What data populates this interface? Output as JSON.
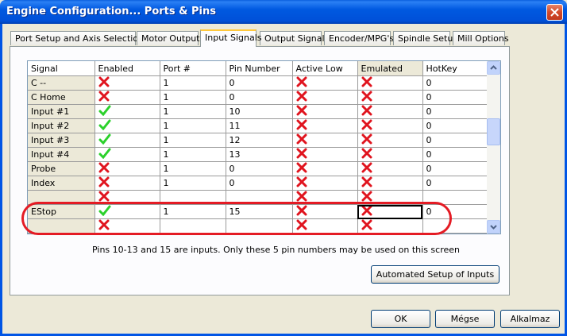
{
  "window": {
    "title": "Engine Configuration... Ports & Pins",
    "close_icon": "close-icon"
  },
  "tabs": [
    {
      "label": "Port Setup and Axis Selection",
      "active": false
    },
    {
      "label": "Motor Outputs",
      "active": false
    },
    {
      "label": "Input Signals",
      "active": true
    },
    {
      "label": "Output Signals",
      "active": false
    },
    {
      "label": "Encoder/MPG's",
      "active": false
    },
    {
      "label": "Spindle Setup",
      "active": false
    },
    {
      "label": "Mill Options",
      "active": false
    }
  ],
  "grid": {
    "columns": [
      "Signal",
      "Enabled",
      "Port #",
      "Pin Number",
      "Active Low",
      "Emulated",
      "HotKey"
    ],
    "rows": [
      {
        "signal": "C --",
        "enabled": false,
        "port": "1",
        "pin": "0",
        "active_low": false,
        "emulated": false,
        "hotkey": "0"
      },
      {
        "signal": "C Home",
        "enabled": false,
        "port": "1",
        "pin": "0",
        "active_low": false,
        "emulated": false,
        "hotkey": "0"
      },
      {
        "signal": "Input #1",
        "enabled": true,
        "port": "1",
        "pin": "10",
        "active_low": false,
        "emulated": false,
        "hotkey": "0"
      },
      {
        "signal": "Input #2",
        "enabled": true,
        "port": "1",
        "pin": "11",
        "active_low": false,
        "emulated": false,
        "hotkey": "0"
      },
      {
        "signal": "Input #3",
        "enabled": true,
        "port": "1",
        "pin": "12",
        "active_low": false,
        "emulated": false,
        "hotkey": "0"
      },
      {
        "signal": "Input #4",
        "enabled": true,
        "port": "1",
        "pin": "13",
        "active_low": false,
        "emulated": false,
        "hotkey": "0"
      },
      {
        "signal": "Probe",
        "enabled": false,
        "port": "1",
        "pin": "0",
        "active_low": false,
        "emulated": false,
        "hotkey": "0"
      },
      {
        "signal": "Index",
        "enabled": false,
        "port": "1",
        "pin": "0",
        "active_low": false,
        "emulated": false,
        "hotkey": "0"
      },
      {
        "signal": "",
        "enabled": false,
        "port": "",
        "pin": "",
        "active_low": false,
        "emulated": false,
        "hotkey": "",
        "partial": true
      },
      {
        "signal": "EStop",
        "enabled": true,
        "port": "1",
        "pin": "15",
        "active_low": false,
        "emulated": false,
        "hotkey": "0",
        "focus": true
      },
      {
        "signal": "",
        "enabled": false,
        "port": "",
        "pin": "",
        "active_low": false,
        "emulated": false,
        "hotkey": "",
        "partial": true
      }
    ],
    "colors": {
      "check": "#2bd12b",
      "cross": "#e0141e",
      "highlight": "#e41b24"
    }
  },
  "note": "Pins 10-13 and 15 are inputs. Only these 5 pin numbers may be used on this screen",
  "buttons": {
    "auto_setup": "Automated Setup of Inputs",
    "ok": "OK",
    "cancel": "Mégse",
    "apply": "Alkalmaz"
  }
}
